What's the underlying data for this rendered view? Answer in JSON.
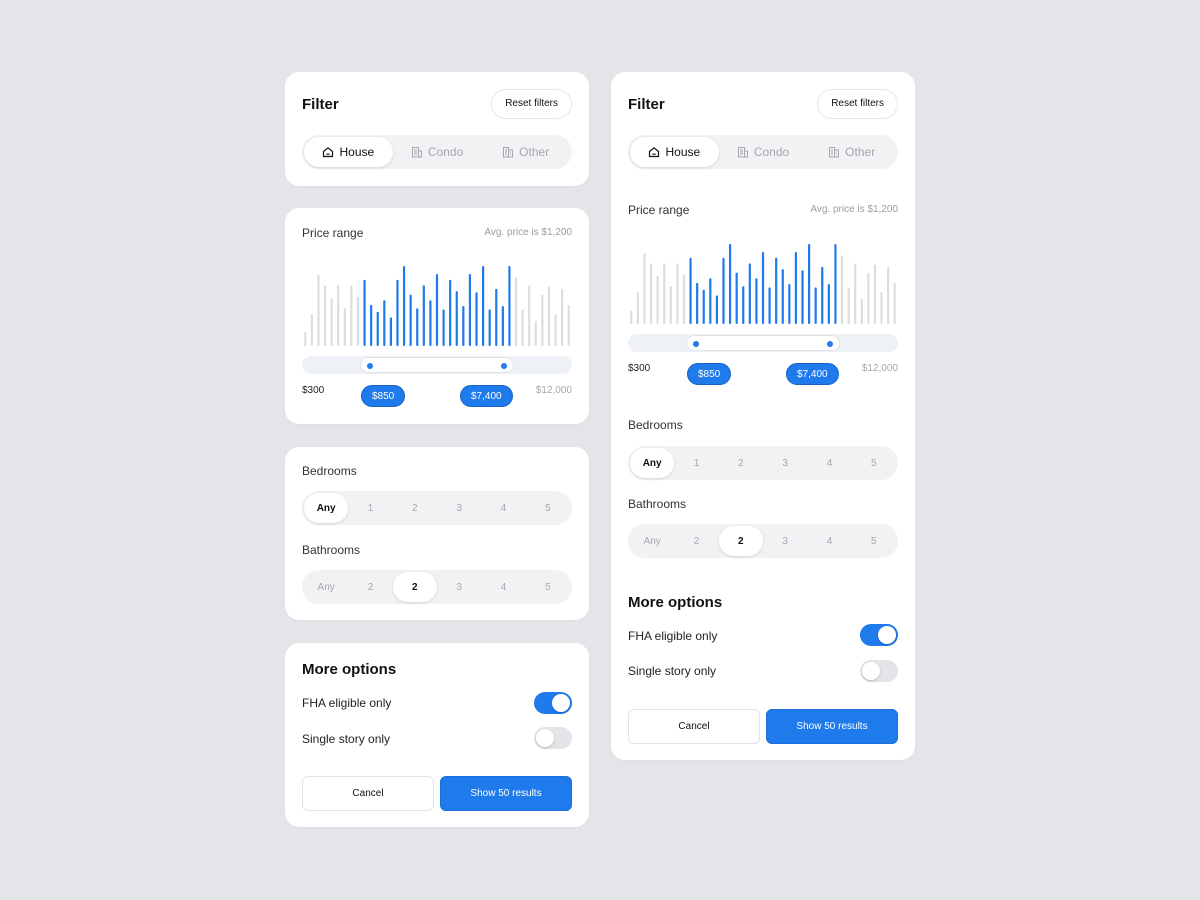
{
  "filter": {
    "title": "Filter",
    "reset_label": "Reset filters",
    "tabs": [
      {
        "label": "House",
        "icon": "house-icon",
        "active": true
      },
      {
        "label": "Condo",
        "icon": "building-icon",
        "active": false
      },
      {
        "label": "Other",
        "icon": "buildings-icon",
        "active": false
      }
    ]
  },
  "price": {
    "label": "Price range",
    "avg": "Avg. price is $1,200",
    "min": "$300",
    "max": "$12,000",
    "low": "$850",
    "high": "$7,400",
    "low_fraction": 0.22,
    "high_fraction": 0.78,
    "histogram": [
      12,
      28,
      62,
      53,
      42,
      53,
      33,
      53,
      43,
      58,
      36,
      30,
      40,
      25,
      58,
      70,
      45,
      33,
      53,
      40,
      63,
      32,
      58,
      48,
      35,
      63,
      47,
      70,
      32,
      50,
      35,
      70,
      60,
      32,
      53,
      22,
      45,
      52,
      28,
      50,
      36
    ],
    "active_from": 9,
    "active_to": 31
  },
  "bedrooms": {
    "label": "Bedrooms",
    "options": [
      "Any",
      "1",
      "2",
      "3",
      "4",
      "5"
    ],
    "selected": 0
  },
  "bathrooms": {
    "label": "Bathrooms",
    "options": [
      "Any",
      "2",
      "2",
      "3",
      "4",
      "5"
    ],
    "selected": 2
  },
  "more": {
    "title": "More options",
    "fha_label": "FHA eligible only",
    "fha_on": true,
    "single_label": "Single story only",
    "single_on": false
  },
  "actions": {
    "cancel_label": "Cancel",
    "show_label": "Show 50 results"
  },
  "colors": {
    "accent": "#1f7aec",
    "inactive_bar": "#dcdde0",
    "background": "#e4e5e9"
  }
}
